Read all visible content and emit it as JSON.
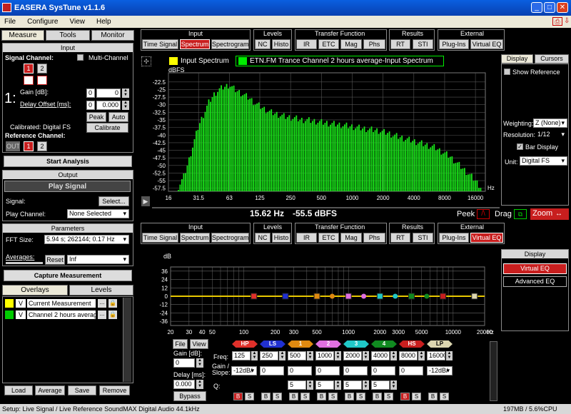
{
  "window": {
    "title": "EASERA SysTune v1.1.6"
  },
  "menu": [
    "File",
    "Configure",
    "View",
    "Help"
  ],
  "left_tabs": [
    "Measure",
    "Tools",
    "Monitor"
  ],
  "input": {
    "header": "Input",
    "signal_channel": "Signal Channel:",
    "multi_channel": "Multi-Channel",
    "ch1": "1",
    "ch2": "2",
    "big_num": "1:",
    "gain_label": "Gain [dB]:",
    "gain_ch": "0",
    "gain_val": "0",
    "delay_label": "Delay Offset [ms]:",
    "delay_ch": "0",
    "delay_val": "0.000",
    "peak": "Peak",
    "auto": "Auto",
    "calibrated": "Calibrated: Digital FS",
    "calibrate": "Calibrate",
    "reference_channel": "Reference Channel:",
    "ref_out": "OUT",
    "ref1": "1",
    "ref2": "2"
  },
  "start_analysis": "Start Analysis",
  "output": {
    "header": "Output",
    "play_signal": "Play Signal",
    "signal_label": "Signal:",
    "select": "Select...",
    "play_channel_label": "Play Channel:",
    "play_channel": "None Selected"
  },
  "parameters": {
    "header": "Parameters",
    "fft_label": "FFT Size:",
    "fft_value": "5.94 s; 262144; 0.17 Hz",
    "averages_label": "Averages:",
    "reset": "Reset",
    "averages_value": "Inf"
  },
  "capture": "Capture Measurement",
  "overlays": {
    "tabs": [
      "Overlays",
      "Levels"
    ],
    "items": [
      {
        "v": "V",
        "name": "Current Measurement",
        "color": "#ffff00"
      },
      {
        "v": "V",
        "name": "Channel 2 hours average",
        "color": "#00cc00"
      }
    ],
    "buttons": [
      "Load",
      "Average",
      "Save",
      "Remove"
    ]
  },
  "toolbar": {
    "groups": [
      {
        "name": "Input",
        "buttons": [
          "Time Signal",
          "Spectrum",
          "Spectrogram"
        ]
      },
      {
        "name": "Levels",
        "buttons": [
          "NC",
          "Histo"
        ]
      },
      {
        "name": "Transfer Function",
        "buttons": [
          "IR",
          "ETC",
          "Mag",
          "Phs"
        ]
      },
      {
        "name": "Results",
        "buttons": [
          "RT",
          "STI"
        ]
      },
      {
        "name": "External",
        "buttons": [
          "Plug-Ins",
          "Virtual EQ"
        ]
      }
    ]
  },
  "top_chart": {
    "legend1": "Input Spectrum",
    "legend2": "ETN.FM Trance Channel 2 hours average-Input Spectrum",
    "ylabel": "dBFS",
    "xunit": "Hz",
    "readout_freq": "15.62 Hz",
    "readout_level": "-55.5 dBFS",
    "peek": "Peek",
    "drag": "Drag",
    "zoom": "Zoom",
    "legend1_color": "#ffff00",
    "legend2_color": "#00ee00"
  },
  "display_panel": {
    "tabs": [
      "Display",
      "Cursors"
    ],
    "show_reference": "Show Reference",
    "weighting_label": "Weighting:",
    "weighting": "Z (None)",
    "resolution_label": "Resolution:",
    "resolution": "1/12",
    "bar_display": "Bar Display",
    "unit_label": "Unit:",
    "unit": "Digital FS"
  },
  "eq_chart": {
    "ylabel": "dB",
    "xunit": "Hz"
  },
  "eq_display": {
    "header": "Display",
    "virtual_eq": "Virtual EQ",
    "advanced_eq": "Advanced EQ"
  },
  "eq_controls": {
    "file": "File",
    "view": "View",
    "gain_label": "Gain [dB]:",
    "gain": "0",
    "delay_label": "Delay [ms]:",
    "delay": "0.000",
    "bypass": "Bypass",
    "freq_label": "Freq:",
    "gain_slope_label": "Gain / Slope:",
    "q_label": "Q:",
    "bands": [
      {
        "name": "HP",
        "color": "#e0302a"
      },
      {
        "name": "LS",
        "color": "#2030d0"
      },
      {
        "name": "1",
        "color": "#e08a10"
      },
      {
        "name": "2",
        "color": "#e070e0"
      },
      {
        "name": "3",
        "color": "#20c8c8"
      },
      {
        "name": "4",
        "color": "#108a20"
      },
      {
        "name": "HS",
        "color": "#c81e1e"
      },
      {
        "name": "LP",
        "color": "#ddd6b0"
      }
    ],
    "freqs": [
      "125",
      "250",
      "500",
      "1000",
      "2000",
      "4000",
      "8000",
      "16000"
    ],
    "gains": [
      "-12dB/",
      "0",
      "0",
      "0",
      "0",
      "0",
      "0",
      "-12dB/"
    ],
    "qs": [
      "5",
      "5",
      "5",
      "5"
    ]
  },
  "status": {
    "left": "Setup: Live Signal / Live Reference SoundMAX Digital Audio 44.1kHz",
    "right": "197MB / 5.6%CPU"
  },
  "chart_data": [
    {
      "type": "bar",
      "ylabel": "dBFS",
      "xlabel": "Hz",
      "ylim": [
        -58.5,
        -19.5
      ],
      "yticks": [
        -22.5,
        -25,
        -27.5,
        -30,
        -32.5,
        -35,
        -37.5,
        -40,
        -42.5,
        -45,
        -47.5,
        -50,
        -52.5,
        -55,
        -57.5
      ],
      "xticks": [
        "16",
        "31.5",
        "63",
        "125",
        "250",
        "500",
        "1000",
        "2000",
        "4000",
        "8000",
        "16000"
      ],
      "x": [
        20,
        22.4,
        25,
        28,
        31.5,
        35.5,
        40,
        45,
        50,
        56,
        63,
        71,
        80,
        90,
        100,
        112,
        125,
        140,
        160,
        180,
        200,
        224,
        250,
        280,
        315,
        355,
        400,
        450,
        500,
        560,
        630,
        710,
        800,
        900,
        1000,
        1120,
        1250,
        1400,
        1600,
        1800,
        2000,
        2240,
        2500,
        2800,
        3150,
        3550,
        4000,
        4500,
        5000,
        5600,
        6300,
        7100,
        8000,
        9000,
        10000,
        11200,
        12500,
        14000,
        16000,
        18000
      ],
      "values": [
        -57,
        -54,
        -49,
        -43,
        -37,
        -33,
        -29,
        -26.5,
        -25,
        -24.2,
        -23.5,
        -25,
        -26,
        -27,
        -28,
        -29.5,
        -30.5,
        -31.5,
        -32.5,
        -33,
        -33.5,
        -34,
        -34.2,
        -34.5,
        -35,
        -35,
        -35.3,
        -35.5,
        -35.8,
        -36,
        -36.3,
        -36.5,
        -36.7,
        -37,
        -37.2,
        -37.5,
        -37.8,
        -38,
        -38.3,
        -38.5,
        -39,
        -39.3,
        -40,
        -40.5,
        -41,
        -41.5,
        -42,
        -42.5,
        -43,
        -43.5,
        -44,
        -45,
        -46,
        -47,
        -48.5,
        -50,
        -51.5,
        -53,
        -55,
        -57
      ]
    },
    {
      "type": "line",
      "ylabel": "dB",
      "xlabel": "Hz",
      "ylim": [
        -42,
        42
      ],
      "yticks": [
        36,
        24,
        12,
        0,
        -12,
        -24,
        -36
      ],
      "xticks": [
        20,
        30,
        40,
        50,
        100,
        200,
        300,
        500,
        1000,
        2000,
        3000,
        5000,
        10000,
        20000
      ],
      "series": [
        {
          "x": [
            20,
            20000
          ],
          "values": [
            0,
            0
          ]
        }
      ],
      "points": [
        {
          "x": 125,
          "y": 0,
          "band": "HP"
        },
        {
          "x": 250,
          "y": 0,
          "band": "LS"
        },
        {
          "x": 500,
          "y": 0,
          "band": "1"
        },
        {
          "x": 1000,
          "y": 0,
          "band": "2"
        },
        {
          "x": 2000,
          "y": 0,
          "band": "3"
        },
        {
          "x": 4000,
          "y": 0,
          "band": "4"
        },
        {
          "x": 8000,
          "y": 0,
          "band": "HS"
        },
        {
          "x": 16000,
          "y": 0,
          "band": "LP"
        }
      ]
    }
  ]
}
